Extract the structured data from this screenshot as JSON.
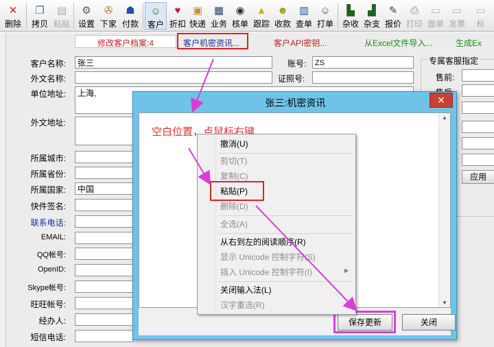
{
  "toolbar": {
    "buttons": [
      {
        "label": "删除",
        "icon": "delete-icon",
        "enabled": true
      },
      {
        "label": "拷贝",
        "icon": "copy-icon",
        "enabled": true
      },
      {
        "label": "粘贴",
        "icon": "paste-icon",
        "enabled": false
      },
      {
        "label": "设置",
        "icon": "settings-icon",
        "enabled": true
      },
      {
        "label": "下家",
        "icon": "supplier-icon",
        "enabled": true
      },
      {
        "label": "付款",
        "icon": "payment-icon",
        "enabled": true
      },
      {
        "label": "客户",
        "icon": "customer-icon",
        "enabled": true
      },
      {
        "label": "折扣",
        "icon": "discount-icon",
        "enabled": true
      },
      {
        "label": "快递",
        "icon": "express-icon",
        "enabled": true
      },
      {
        "label": "业务",
        "icon": "business-icon",
        "enabled": true
      },
      {
        "label": "核单",
        "icon": "check-order-icon",
        "enabled": true
      },
      {
        "label": "跟踪",
        "icon": "track-icon",
        "enabled": true
      },
      {
        "label": "收款",
        "icon": "receipt-icon",
        "enabled": true
      },
      {
        "label": "查单",
        "icon": "search-order-icon",
        "enabled": true
      },
      {
        "label": "打单",
        "icon": "print-order-icon",
        "enabled": true
      },
      {
        "label": "杂收",
        "icon": "misc-receive-icon",
        "enabled": true
      },
      {
        "label": "杂支",
        "icon": "misc-pay-icon",
        "enabled": true
      },
      {
        "label": "报价",
        "icon": "quote-icon",
        "enabled": true
      },
      {
        "label": "打印",
        "icon": "print-icon",
        "enabled": false
      },
      {
        "label": "面单",
        "icon": "waybill-icon",
        "enabled": false
      },
      {
        "label": "发票",
        "icon": "invoice-icon",
        "enabled": false
      },
      {
        "label": "标",
        "icon": "label-icon",
        "enabled": false
      }
    ]
  },
  "subtoolbar": {
    "edit_archive": "修改客户档案:4",
    "confidential": "客户机密资讯...",
    "api_key": "客户API密钥...",
    "excel_import": "从Excel文件导入...",
    "generate": "生成Ex"
  },
  "form": {
    "customer_name_label": "客户名称:",
    "customer_name": "张三",
    "foreign_name_label": "外文名称:",
    "unit_address_label": "单位地址:",
    "unit_address": "上海,",
    "foreign_address_label": "外文地址:",
    "city_label": "所属城市:",
    "province_label": "所属省份:",
    "country_label": "所属国家:",
    "country": "中国",
    "express_sign_label": "快件签名:",
    "contact_phone_label": "联系电话:",
    "email_label": "EMAIL:",
    "qq_label": "QQ帐号:",
    "openid_label": "OpenID:",
    "skype_label": "Skype帐号:",
    "wangwang_label": "旺旺帐号:",
    "agent_label": "经办人:",
    "sms_label": "短信电话:",
    "account_label": "账号:",
    "account": "ZS",
    "id_label": "证照号:",
    "service_title": "专属客服指定",
    "presale_label": "售前:",
    "aftersale_label": "售后:",
    "apply_btn": "应用"
  },
  "dialog": {
    "title": "张三:机密资讯",
    "close": "✕",
    "hint": "空白位置，点鼠标右键",
    "save_btn": "保存更新",
    "close_btn": "关闭"
  },
  "context_menu": {
    "items": [
      {
        "label": "撤消(U)",
        "enabled": true
      },
      {
        "label": "剪切(T)",
        "enabled": false
      },
      {
        "label": "复制(C)",
        "enabled": false
      },
      {
        "label": "粘贴(P)",
        "enabled": true
      },
      {
        "label": "删除(D)",
        "enabled": false
      },
      {
        "label": "全选(A)",
        "enabled": false
      },
      {
        "label": "从右到左的阅读顺序(R)",
        "enabled": true
      },
      {
        "label": "显示 Unicode 控制字符(S)",
        "enabled": false
      },
      {
        "label": "插入 Unicode 控制字符(I)",
        "enabled": false
      },
      {
        "label": "关闭输入法(L)",
        "enabled": true
      },
      {
        "label": "汉字重选(R)",
        "enabled": false
      }
    ]
  },
  "colors": {
    "highlight_red": "#e02020",
    "annotation_magenta": "#d63fd6",
    "dialog_blue": "#6fc3e8"
  }
}
